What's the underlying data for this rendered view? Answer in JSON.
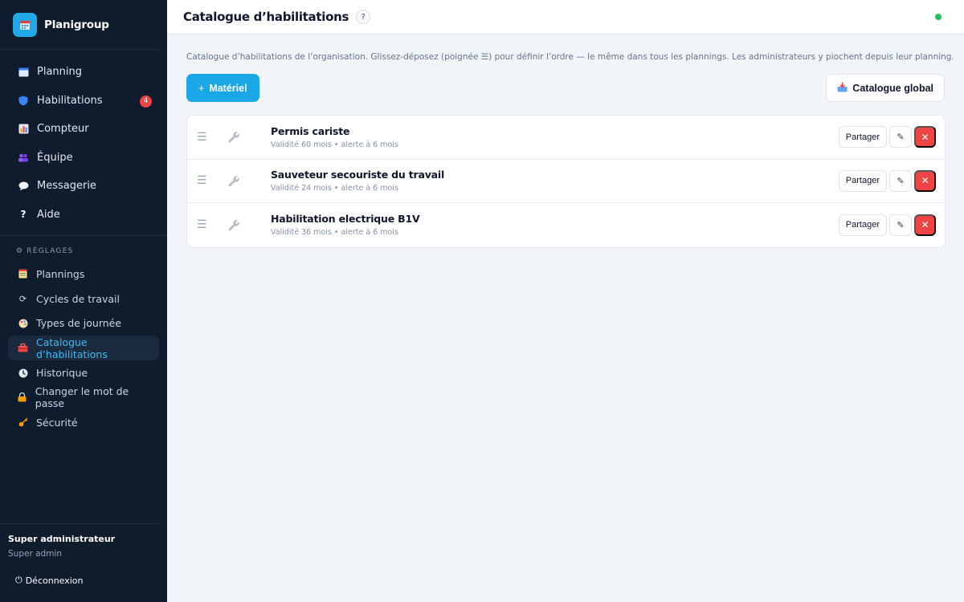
{
  "app": {
    "name": "Planigroup"
  },
  "sidebar": {
    "items": [
      {
        "label": "Planning",
        "icon": "calendar-icon"
      },
      {
        "label": "Habilitations",
        "icon": "shield-icon",
        "badge": "4"
      },
      {
        "label": "Compteur",
        "icon": "bar-chart-icon"
      },
      {
        "label": "Équipe",
        "icon": "team-icon"
      },
      {
        "label": "Messagerie",
        "icon": "chat-icon"
      },
      {
        "label": "Aide",
        "icon": "question-icon"
      }
    ],
    "settings_label": "RÉGLAGES",
    "settings": [
      {
        "label": "Plannings",
        "icon": "notepad-icon"
      },
      {
        "label": "Cycles de travail",
        "icon": "cycle-icon"
      },
      {
        "label": "Types de journée",
        "icon": "palette-icon"
      },
      {
        "label": "Catalogue d’habilitations",
        "icon": "toolbox-icon",
        "active": true
      },
      {
        "label": "Historique",
        "icon": "clock-icon"
      },
      {
        "label": "Changer le mot de passe",
        "icon": "lock-icon"
      },
      {
        "label": "Sécurité",
        "icon": "key-icon"
      }
    ],
    "user": {
      "role": "Super administrateur",
      "sub": "Super admin"
    },
    "logout_label": "Déconnexion"
  },
  "header": {
    "title": "Catalogue d’habilitations",
    "help": "?",
    "status_color": "#22c55e"
  },
  "main": {
    "intro": "Catalogue d’habilitations de l’organisation. Glissez-déposez (poignée ☰) pour définir l’ordre — le même dans tous les plannings. Les administrateurs y piochent depuis leur planning.",
    "add_button": "Matériel",
    "global_button": "Catalogue global",
    "share_label": "Partager",
    "items": [
      {
        "name": "Permis cariste",
        "meta": "Validité 60 mois • alerte à 6 mois"
      },
      {
        "name": "Sauveteur secouriste du travail",
        "meta": "Validité 24 mois • alerte à 6 mois"
      },
      {
        "name": "Habilitation electrique B1V",
        "meta": "Validité 36 mois • alerte à 6 mois"
      }
    ]
  },
  "colors": {
    "accent": "#1aa7e8",
    "sidebar_bg": "#0f1c2e",
    "danger": "#ef4444",
    "active_text": "#38bdf8"
  }
}
